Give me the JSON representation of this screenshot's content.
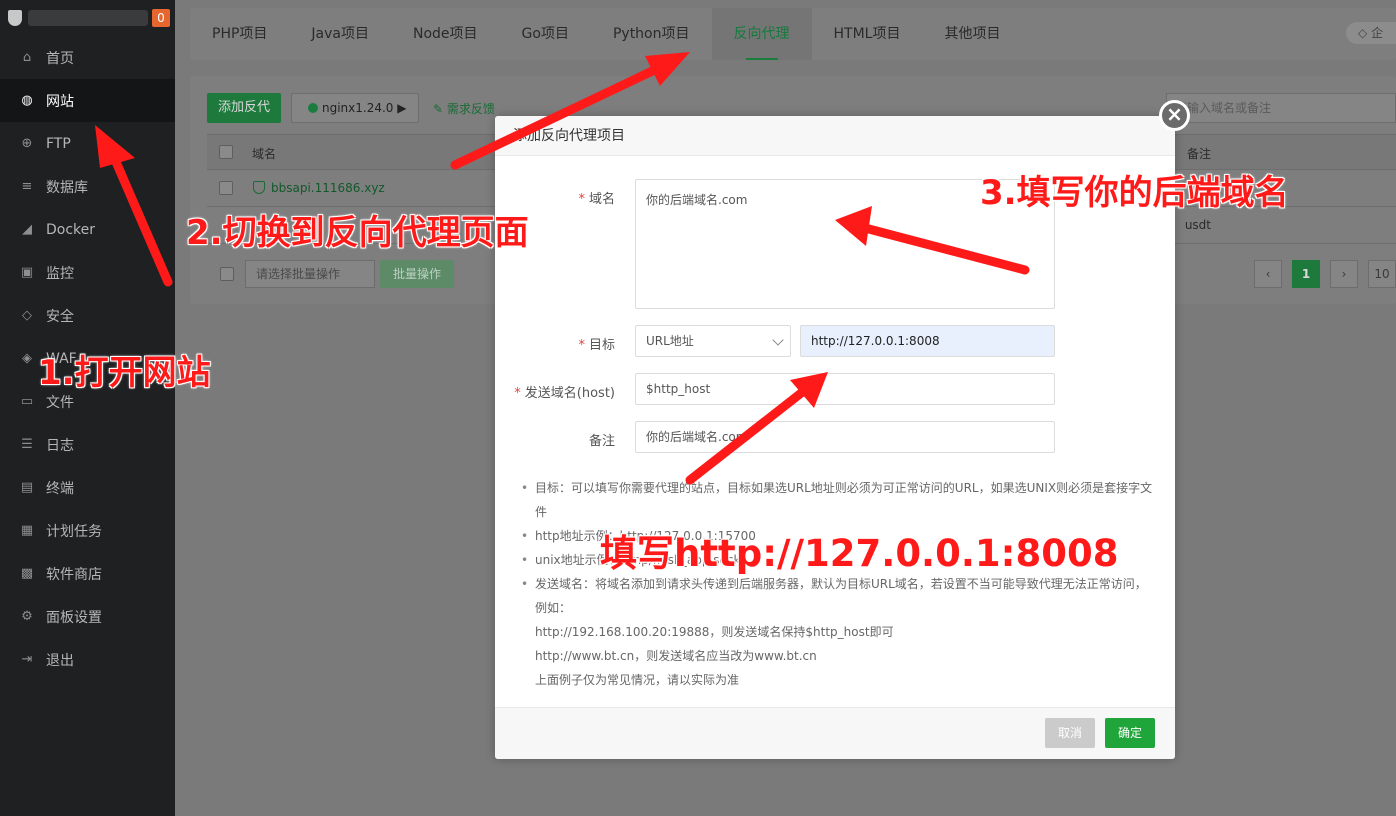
{
  "sidebar": {
    "badge": "0",
    "items": [
      {
        "label": "首页",
        "icon": "home-icon",
        "glyph": "⌂"
      },
      {
        "label": "网站",
        "icon": "globe-icon",
        "glyph": "◍"
      },
      {
        "label": "FTP",
        "icon": "ftp-icon",
        "glyph": "⊕"
      },
      {
        "label": "数据库",
        "icon": "database-icon",
        "glyph": "≡"
      },
      {
        "label": "Docker",
        "icon": "docker-icon",
        "glyph": "◢"
      },
      {
        "label": "监控",
        "icon": "monitor-icon",
        "glyph": "▣"
      },
      {
        "label": "安全",
        "icon": "shield-icon",
        "glyph": "◇"
      },
      {
        "label": "WAF",
        "icon": "waf-icon",
        "glyph": "◈"
      },
      {
        "label": "文件",
        "icon": "folder-icon",
        "glyph": "▭"
      },
      {
        "label": "日志",
        "icon": "log-icon",
        "glyph": "☰"
      },
      {
        "label": "终端",
        "icon": "terminal-icon",
        "glyph": "▤"
      },
      {
        "label": "计划任务",
        "icon": "cron-icon",
        "glyph": "▦"
      },
      {
        "label": "软件商店",
        "icon": "store-icon",
        "glyph": "▩"
      },
      {
        "label": "面板设置",
        "icon": "settings-icon",
        "glyph": "⚙"
      },
      {
        "label": "退出",
        "icon": "logout-icon",
        "glyph": "⇥"
      }
    ]
  },
  "tabs": [
    "PHP项目",
    "Java项目",
    "Node项目",
    "Go项目",
    "Python项目",
    "反向代理",
    "HTML项目",
    "其他项目"
  ],
  "vip_label": "企",
  "toolbar": {
    "add_proxy": "添加反代",
    "nginx": "nginx1.24.0 ▶",
    "feedback": "需求反馈",
    "search_placeholder": "请输入域名或备注"
  },
  "table": {
    "col_domain": "域名",
    "col_note": "备注",
    "row_domain": "bbsapi.111686.xyz",
    "row_note": "usdt",
    "bulk_placeholder": "请选择批量操作",
    "bulk_button": "批量操作",
    "page_prev": "‹",
    "page_current": "1",
    "page_next": "›",
    "page_size": "10"
  },
  "modal": {
    "title": "添加反向代理项目",
    "close": "×",
    "label_domain": "域名",
    "domain_placeholder": "你的后端域名.com",
    "label_target": "目标",
    "target_type": "URL地址",
    "target_url": "http://127.0.0.1:8008",
    "label_host": "发送域名(host)",
    "host_value": "$http_host",
    "label_remark": "备注",
    "remark_value": "你的后端域名.com",
    "help": [
      "目标：可以填写你需要代理的站点，目标如果选URL地址则必须为可正常访问的URL，如果选UNIX则必须是套接字文件",
      "http地址示例：http://127.0.0.1:15700",
      "unix地址示例：/tmp/flask_app.sock",
      "发送域名：将域名添加到请求头传递到后端服务器，默认为目标URL域名，若设置不当可能导致代理无法正常访问，例如：",
      "http://192.168.100.20:19888，则发送域名保持$http_host即可",
      "http://www.bt.cn，则发送域名应当改为www.bt.cn",
      "上面例子仅为常见情况，请以实际为准"
    ],
    "cancel": "取消",
    "confirm": "确定"
  },
  "annotations": {
    "step1": "1.打开网站",
    "step2": "2.切换到反向代理页面",
    "step3": "3.填写你的后端域名",
    "step4": "填写http://127.0.0.1:8008",
    "color": "#ff1a1a"
  }
}
